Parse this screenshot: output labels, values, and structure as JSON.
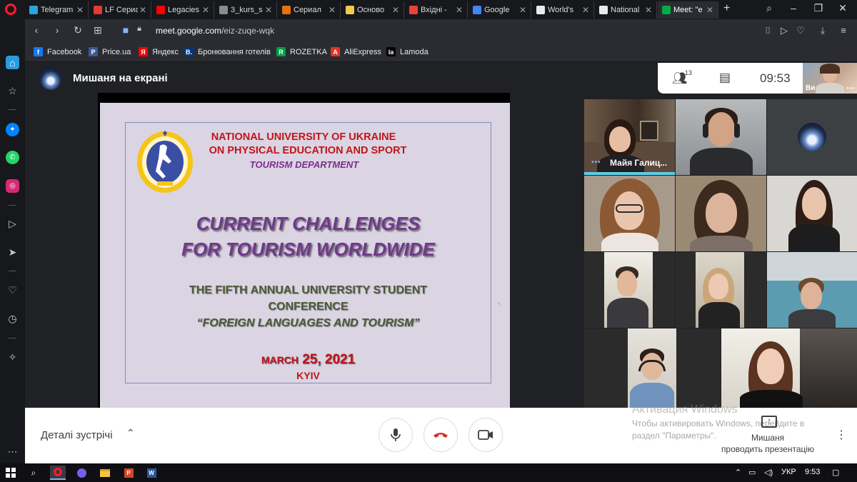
{
  "browser": {
    "tabs": [
      {
        "title": "Telegram",
        "fav_color": "#2aa3df",
        "active": false
      },
      {
        "title": "LF Сериал",
        "fav_color": "#e53935",
        "active": false
      },
      {
        "title": "Legacies",
        "fav_color": "#ff0000",
        "active": false
      },
      {
        "title": "3_kurs_s",
        "fav_color": "#8a8a8a",
        "active": false
      },
      {
        "title": "Сериал",
        "fav_color": "#e8710a",
        "active": false
      },
      {
        "title": "Осново",
        "fav_color": "#f2c94c",
        "active": false
      },
      {
        "title": "Вхідні -",
        "fav_color": "#ea4335",
        "active": false
      },
      {
        "title": "Google",
        "fav_color": "#4285f4",
        "active": false
      },
      {
        "title": "World's",
        "fav_color": "#e8eaed",
        "active": false
      },
      {
        "title": "National",
        "fav_color": "#e8eaed",
        "active": false
      },
      {
        "title": "Meet: \"e",
        "fav_color": "#00ac47",
        "active": true
      }
    ],
    "url_host": "meet.google.com",
    "url_path": "/eiz-zuqe-wqk",
    "bookmarks": [
      {
        "label": "Facebook",
        "icon": "f",
        "color": "#1877f2"
      },
      {
        "label": "Price.ua",
        "icon": "P",
        "color": "#3b5998"
      },
      {
        "label": "Яндекс",
        "icon": "Я",
        "color": "#ff0000"
      },
      {
        "label": "Бронювання готелів",
        "icon": "B.",
        "color": "#003580"
      },
      {
        "label": "ROZETKA",
        "icon": "R",
        "color": "#00a046"
      },
      {
        "label": "AliExpress",
        "icon": "A",
        "color": "#e43225"
      },
      {
        "label": "Lamoda",
        "icon": "la",
        "color": "#000000"
      }
    ]
  },
  "meet": {
    "presenter_title": "Мишаня на екрані",
    "participants_count": "13",
    "time": "09:53",
    "self_label": "Ви",
    "tile_name": "Майя Галиц...",
    "details_label": "Деталі зустрічі",
    "present_line1": "Мишаня",
    "present_line2": "проводить презентацію",
    "watermark_title": "Активация Windows",
    "watermark_line1": "Чтобы активировать Windows, перейдите в",
    "watermark_line2": "раздел \"Параметры\"."
  },
  "slide": {
    "univ_line1": "NATIONAL UNIVERSITY OF UKRAINE",
    "univ_line2": "ON PHYSICAL EDUCATION AND SPORT",
    "department": "TOURISM DEPARTMENT",
    "title_line1": "CURRENT CHALLENGES",
    "title_line2": "FOR TOURISM WORLDWIDE",
    "sub_line1": "THE FIFTH ANNUAL UNIVERSITY STUDENT",
    "sub_line2": "CONFERENCE",
    "sub_line3": "“FOREIGN LANGUAGES AND TOURISM”",
    "date_month": "MARCH",
    "date_day": " 25, 2021",
    "city": "KYIV"
  },
  "taskbar": {
    "lang": "УКР",
    "time": "9:53"
  },
  "colors": {
    "meet_bg": "#202124",
    "speaking": "#5ccfe6",
    "end_call": "#d93025",
    "slide_red": "#c0151b",
    "slide_purple": "#6e3a8a"
  }
}
